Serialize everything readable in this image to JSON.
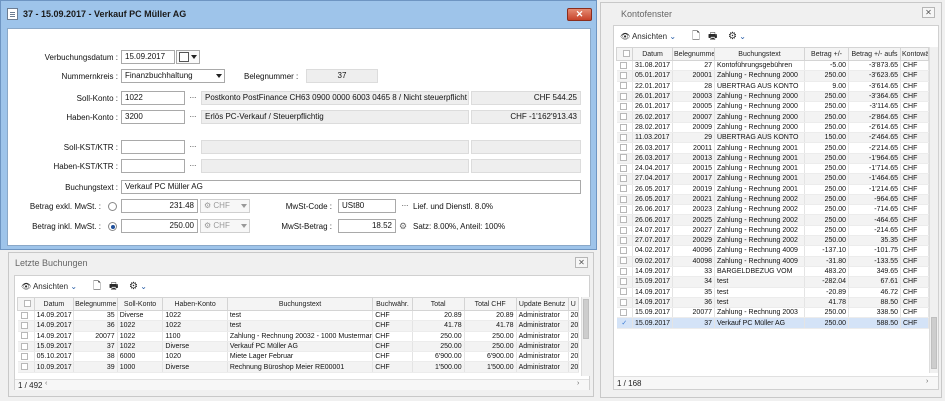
{
  "dialog": {
    "title": "37 - 15.09.2017 - Verkauf PC Müller AG",
    "close_label": "✕",
    "buchungsdatum_label": "Verbuchungsdatum :",
    "buchungsdatum_value": "15.09.2017",
    "nummernkreis_label": "Nummernkreis :",
    "nummernkreis_value": "Finanzbuchhaltung",
    "belegnummer_label": "Belegnummer :",
    "belegnummer_value": "37",
    "soll_konto_label": "Soll-Konto :",
    "soll_konto_value": "1022",
    "soll_konto_desc": "Postkonto PostFinance CH63 0900 0000 6003 0465 8 / Nicht steuerpflicht",
    "soll_konto_balance": "CHF 544.25",
    "haben_konto_label": "Haben-Konto :",
    "haben_konto_value": "3200",
    "haben_konto_desc": "Erlös PC-Verkauf / Steuerpflichtig",
    "haben_konto_balance": "CHF -1'162'913.43",
    "soll_kst_label": "Soll-KST/KTR :",
    "haben_kst_label": "Haben-KST/KTR :",
    "buchungstext_label": "Buchungstext :",
    "buchungstext_value": "Verkauf PC Müller AG",
    "betrag_exkl_label": "Betrag exkl. MwSt. :",
    "betrag_exkl_value": "231.48",
    "betrag_inkl_label": "Betrag inkl. MwSt. :",
    "betrag_inkl_value": "250.00",
    "currency": "CHF",
    "mwst_code_label": "MwSt-Code :",
    "mwst_code_value": "USt80",
    "mwst_code_desc": "Lief. und Dienstl. 8.0%",
    "mwst_betrag_label": "MwSt-Betrag :",
    "mwst_betrag_value": "18.52",
    "mwst_betrag_desc": "Satz: 8.00%, Anteil: 100%",
    "dots": "...",
    "selected_radio": "inkl"
  },
  "letzte": {
    "title": "Letzte Buchungen",
    "ansichten": "Ansichten",
    "columns": [
      "",
      "Datum",
      "Belegnumme",
      "Soll-Konto",
      "Haben-Konto",
      "Buchungstext",
      "Buchwähr.",
      "Total",
      "Total CHF",
      "Update Benutz",
      "U"
    ],
    "rows": [
      [
        "14.09.2017",
        "35",
        "Diverse",
        "1022",
        "test",
        "CHF",
        "20.89",
        "20.89",
        "Administrator",
        "20"
      ],
      [
        "14.09.2017",
        "36",
        "1022",
        "1022",
        "test",
        "CHF",
        "41.78",
        "41.78",
        "Administrator",
        "20"
      ],
      [
        "14.09.2017",
        "20077",
        "1022",
        "1100",
        "Zahlung - Rechnung 20032 - 1000 Mustermann",
        "CHF",
        "250.00",
        "250.00",
        "Administrator",
        "20"
      ],
      [
        "15.09.2017",
        "37",
        "1022",
        "Diverse",
        "Verkauf PC Müller AG",
        "CHF",
        "250.00",
        "250.00",
        "Administrator",
        "20"
      ],
      [
        "05.10.2017",
        "38",
        "6000",
        "1020",
        "Miete Lager Februar",
        "CHF",
        "6'900.00",
        "6'900.00",
        "Administrator",
        "20"
      ],
      [
        "10.09.2017",
        "39",
        "1000",
        "Diverse",
        "Rechnung Büroshop Meier RE00001",
        "CHF",
        "1'500.00",
        "1'500.00",
        "Administrator",
        "20"
      ]
    ],
    "count": "1 / 492"
  },
  "konto": {
    "title": "Kontofenster",
    "ansichten": "Ansichten",
    "columns": [
      "",
      "Datum",
      "Belegnumme",
      "Buchungstext",
      "Betrag +/-",
      "Betrag +/- aufs",
      "Kontowä"
    ],
    "rows": [
      [
        "31.08.2017",
        "27",
        "Kontoführungsgebühren",
        "-5.00",
        "-3'873.65",
        "CHF"
      ],
      [
        "05.01.2017",
        "20001",
        "Zahlung - Rechnung 2000",
        "250.00",
        "-3'623.65",
        "CHF"
      ],
      [
        "22.01.2017",
        "28",
        "ÜBERTRAG AUS KONTO",
        "9.00",
        "-3'614.65",
        "CHF"
      ],
      [
        "26.01.2017",
        "20003",
        "Zahlung - Rechnung 2000",
        "250.00",
        "-3'364.65",
        "CHF"
      ],
      [
        "26.01.2017",
        "20005",
        "Zahlung - Rechnung 2000",
        "250.00",
        "-3'114.65",
        "CHF"
      ],
      [
        "26.02.2017",
        "20007",
        "Zahlung - Rechnung 2000",
        "250.00",
        "-2'864.65",
        "CHF"
      ],
      [
        "28.02.2017",
        "20009",
        "Zahlung - Rechnung 2000",
        "250.00",
        "-2'614.65",
        "CHF"
      ],
      [
        "11.03.2017",
        "29",
        "ÜBERTRAG AUS KONTO",
        "150.00",
        "-2'464.65",
        "CHF"
      ],
      [
        "26.03.2017",
        "20011",
        "Zahlung - Rechnung 2001",
        "250.00",
        "-2'214.65",
        "CHF"
      ],
      [
        "26.03.2017",
        "20013",
        "Zahlung - Rechnung 2001",
        "250.00",
        "-1'964.65",
        "CHF"
      ],
      [
        "24.04.2017",
        "20015",
        "Zahlung - Rechnung 2001",
        "250.00",
        "-1'714.65",
        "CHF"
      ],
      [
        "27.04.2017",
        "20017",
        "Zahlung - Rechnung 2001",
        "250.00",
        "-1'464.65",
        "CHF"
      ],
      [
        "26.05.2017",
        "20019",
        "Zahlung - Rechnung 2001",
        "250.00",
        "-1'214.65",
        "CHF"
      ],
      [
        "26.05.2017",
        "20021",
        "Zahlung - Rechnung 2002",
        "250.00",
        "-964.65",
        "CHF"
      ],
      [
        "26.06.2017",
        "20023",
        "Zahlung - Rechnung 2002",
        "250.00",
        "-714.65",
        "CHF"
      ],
      [
        "26.06.2017",
        "20025",
        "Zahlung - Rechnung 2002",
        "250.00",
        "-464.65",
        "CHF"
      ],
      [
        "24.07.2017",
        "20027",
        "Zahlung - Rechnung 2002",
        "250.00",
        "-214.65",
        "CHF"
      ],
      [
        "27.07.2017",
        "20029",
        "Zahlung - Rechnung 2002",
        "250.00",
        "35.35",
        "CHF"
      ],
      [
        "04.02.2017",
        "40096",
        "Zahlung - Rechnung 4009",
        "-137.10",
        "-101.75",
        "CHF"
      ],
      [
        "09.02.2017",
        "40098",
        "Zahlung - Rechnung 4009",
        "-31.80",
        "-133.55",
        "CHF"
      ],
      [
        "14.09.2017",
        "33",
        "BARGELDBEZUG VOM",
        "483.20",
        "349.65",
        "CHF"
      ],
      [
        "15.09.2017",
        "34",
        "test",
        "-282.04",
        "67.61",
        "CHF"
      ],
      [
        "14.09.2017",
        "35",
        "test",
        "-20.89",
        "46.72",
        "CHF"
      ],
      [
        "14.09.2017",
        "36",
        "test",
        "41.78",
        "88.50",
        "CHF"
      ],
      [
        "15.09.2017",
        "20077",
        "Zahlung - Rechnung 2003",
        "250.00",
        "338.50",
        "CHF"
      ],
      [
        "15.09.2017",
        "37",
        "Verkauf PC Müller AG",
        "250.00",
        "588.50",
        "CHF"
      ]
    ],
    "count": "1 / 168",
    "selected_row": 25
  }
}
